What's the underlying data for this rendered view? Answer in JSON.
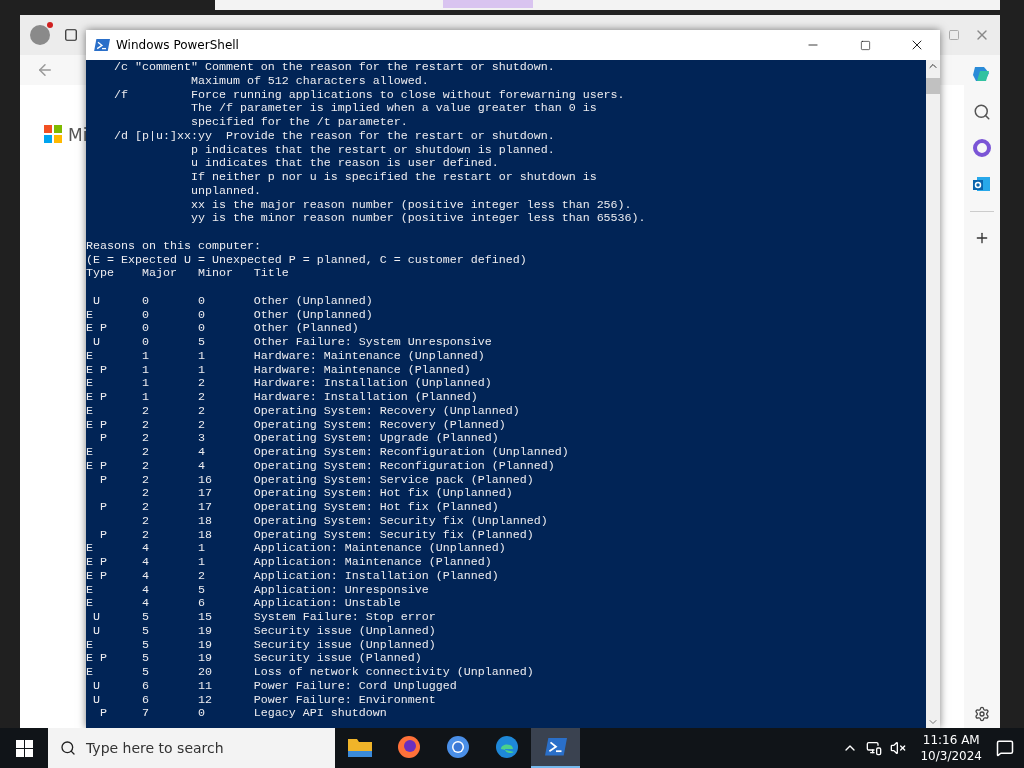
{
  "browser": {
    "logo_text": "Mi"
  },
  "powershell": {
    "title": "Windows PowerShell",
    "help_lines": [
      "    /c \"comment\" Comment on the reason for the restart or shutdown.",
      "               Maximum of 512 characters allowed.",
      "    /f         Force running applications to close without forewarning users.",
      "               The /f parameter is implied when a value greater than 0 is",
      "               specified for the /t parameter.",
      "    /d [p|u:]xx:yy  Provide the reason for the restart or shutdown.",
      "               p indicates that the restart or shutdown is planned.",
      "               u indicates that the reason is user defined.",
      "               If neither p nor u is specified the restart or shutdown is",
      "               unplanned.",
      "               xx is the major reason number (positive integer less than 256).",
      "               yy is the minor reason number (positive integer less than 65536)."
    ],
    "reasons_heading": "Reasons on this computer:",
    "legend": "(E = Expected U = Unexpected P = planned, C = customer defined)",
    "columns": [
      "Type",
      "Major",
      "Minor",
      "Title"
    ],
    "rows": [
      {
        "type": " U",
        "major": "0",
        "minor": "0",
        "title": "Other (Unplanned)"
      },
      {
        "type": "E",
        "major": "0",
        "minor": "0",
        "title": "Other (Unplanned)"
      },
      {
        "type": "E P",
        "major": "0",
        "minor": "0",
        "title": "Other (Planned)"
      },
      {
        "type": " U",
        "major": "0",
        "minor": "5",
        "title": "Other Failure: System Unresponsive"
      },
      {
        "type": "E",
        "major": "1",
        "minor": "1",
        "title": "Hardware: Maintenance (Unplanned)"
      },
      {
        "type": "E P",
        "major": "1",
        "minor": "1",
        "title": "Hardware: Maintenance (Planned)"
      },
      {
        "type": "E",
        "major": "1",
        "minor": "2",
        "title": "Hardware: Installation (Unplanned)"
      },
      {
        "type": "E P",
        "major": "1",
        "minor": "2",
        "title": "Hardware: Installation (Planned)"
      },
      {
        "type": "E",
        "major": "2",
        "minor": "2",
        "title": "Operating System: Recovery (Unplanned)"
      },
      {
        "type": "E P",
        "major": "2",
        "minor": "2",
        "title": "Operating System: Recovery (Planned)"
      },
      {
        "type": "  P",
        "major": "2",
        "minor": "3",
        "title": "Operating System: Upgrade (Planned)"
      },
      {
        "type": "E",
        "major": "2",
        "minor": "4",
        "title": "Operating System: Reconfiguration (Unplanned)"
      },
      {
        "type": "E P",
        "major": "2",
        "minor": "4",
        "title": "Operating System: Reconfiguration (Planned)"
      },
      {
        "type": "  P",
        "major": "2",
        "minor": "16",
        "title": "Operating System: Service pack (Planned)"
      },
      {
        "major": "2",
        "minor": "17",
        "title": "Operating System: Hot fix (Unplanned)"
      },
      {
        "type": "  P",
        "major": "2",
        "minor": "17",
        "title": "Operating System: Hot fix (Planned)"
      },
      {
        "major": "2",
        "minor": "18",
        "title": "Operating System: Security fix (Unplanned)"
      },
      {
        "type": "  P",
        "major": "2",
        "minor": "18",
        "title": "Operating System: Security fix (Planned)"
      },
      {
        "type": "E",
        "major": "4",
        "minor": "1",
        "title": "Application: Maintenance (Unplanned)"
      },
      {
        "type": "E P",
        "major": "4",
        "minor": "1",
        "title": "Application: Maintenance (Planned)"
      },
      {
        "type": "E P",
        "major": "4",
        "minor": "2",
        "title": "Application: Installation (Planned)"
      },
      {
        "type": "E",
        "major": "4",
        "minor": "5",
        "title": "Application: Unresponsive"
      },
      {
        "type": "E",
        "major": "4",
        "minor": "6",
        "title": "Application: Unstable"
      },
      {
        "type": " U",
        "major": "5",
        "minor": "15",
        "title": "System Failure: Stop error"
      },
      {
        "type": " U",
        "major": "5",
        "minor": "19",
        "title": "Security issue (Unplanned)"
      },
      {
        "type": "E",
        "major": "5",
        "minor": "19",
        "title": "Security issue (Unplanned)"
      },
      {
        "type": "E P",
        "major": "5",
        "minor": "19",
        "title": "Security issue (Planned)"
      },
      {
        "type": "E",
        "major": "5",
        "minor": "20",
        "title": "Loss of network connectivity (Unplanned)"
      },
      {
        "type": " U",
        "major": "6",
        "minor": "11",
        "title": "Power Failure: Cord Unplugged"
      },
      {
        "type": " U",
        "major": "6",
        "minor": "12",
        "title": "Power Failure: Environment"
      },
      {
        "type": "  P",
        "major": "7",
        "minor": "0",
        "title": "Legacy API shutdown"
      }
    ]
  },
  "taskbar": {
    "search_placeholder": "Type here to search",
    "apps": [
      {
        "kind": "files",
        "selected": false
      },
      {
        "kind": "firefox",
        "selected": false
      },
      {
        "kind": "chrome",
        "selected": false
      },
      {
        "kind": "edge",
        "selected": false
      },
      {
        "kind": "powershell",
        "selected": true
      }
    ],
    "time": "11:16 AM",
    "date": "10/3/2024"
  }
}
